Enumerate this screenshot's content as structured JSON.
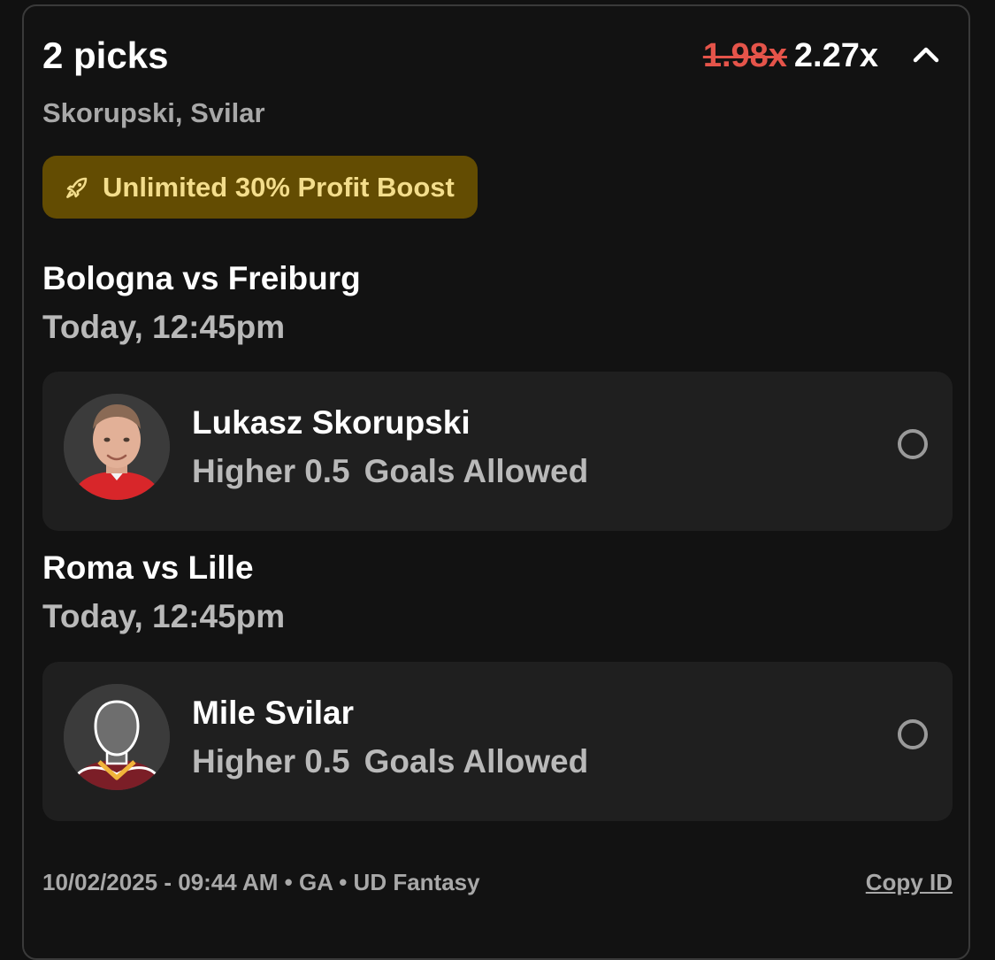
{
  "header": {
    "title": "2 picks",
    "old_multiplier": "1.98x",
    "new_multiplier": "2.27x",
    "players_summary": "Skorupski, Svilar",
    "collapse_icon": "chevron-up-icon"
  },
  "boost": {
    "icon": "rocket-icon",
    "label": "Unlimited 30% Profit Boost",
    "background_color": "#634c02",
    "text_color": "#f3dd8c"
  },
  "picks": [
    {
      "match": "Bologna vs Freiburg",
      "time": "Today, 12:45pm",
      "player": "Lukasz Skorupski",
      "direction": "Higher",
      "line": "0.5",
      "stat": "Goals Allowed",
      "avatar": "player-photo"
    },
    {
      "match": "Roma vs Lille",
      "time": "Today, 12:45pm",
      "player": "Mile Svilar",
      "direction": "Higher",
      "line": "0.5",
      "stat": "Goals Allowed",
      "avatar": "player-silhouette"
    }
  ],
  "footer": {
    "meta": "10/02/2025 - 09:44 AM • GA • UD Fantasy",
    "copy_id": "Copy ID"
  },
  "colors": {
    "background": "#111111",
    "card_border": "#3a3a3a",
    "pick_background": "#1f1f1f",
    "old_multiplier": "#e5544a"
  }
}
